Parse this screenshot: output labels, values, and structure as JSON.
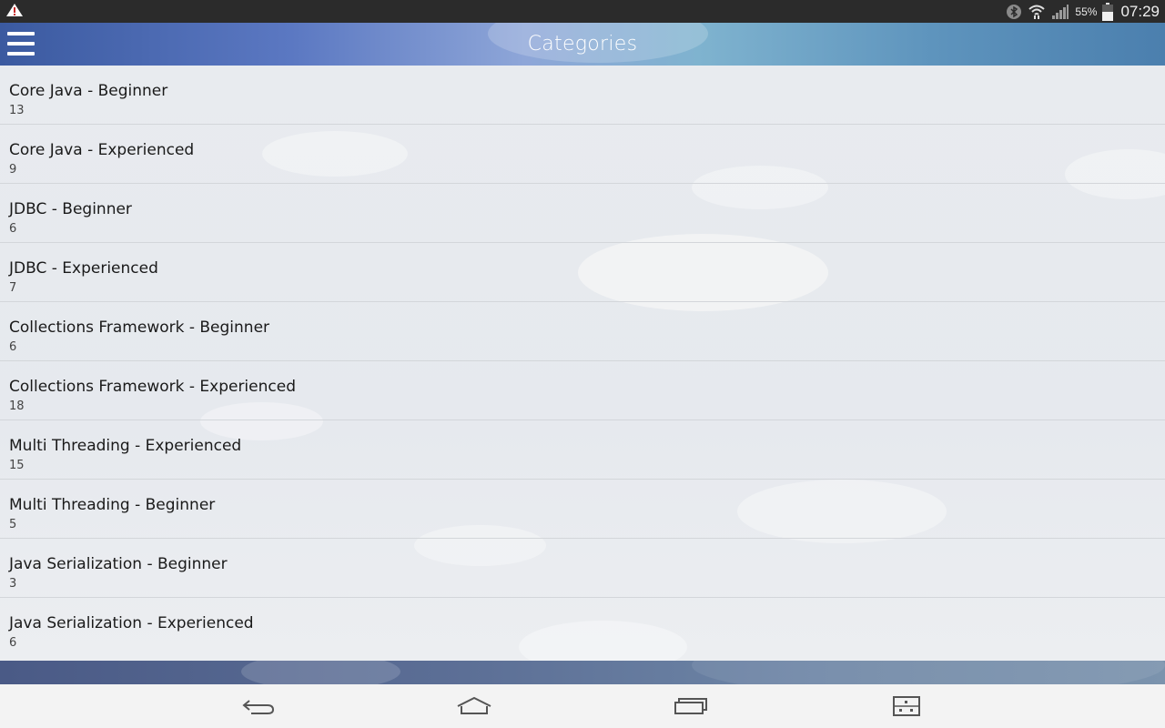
{
  "status_bar": {
    "battery_percent": "55%",
    "clock": "07:29",
    "icons": [
      "warning-icon",
      "bluetooth-icon",
      "wifi-icon",
      "signal-icon",
      "battery-icon"
    ]
  },
  "action_bar": {
    "title": "Categories",
    "menu_icon": "hamburger-menu-icon"
  },
  "categories": [
    {
      "name": "Core Java - Beginner",
      "count": "13"
    },
    {
      "name": "Core Java - Experienced",
      "count": "9"
    },
    {
      "name": "JDBC - Beginner",
      "count": "6"
    },
    {
      "name": "JDBC - Experienced",
      "count": "7"
    },
    {
      "name": "Collections Framework - Beginner",
      "count": "6"
    },
    {
      "name": "Collections Framework - Experienced",
      "count": "18"
    },
    {
      "name": "Multi Threading - Experienced",
      "count": "15"
    },
    {
      "name": "Multi Threading - Beginner",
      "count": "5"
    },
    {
      "name": "Java Serialization - Beginner",
      "count": "3"
    },
    {
      "name": "Java Serialization - Experienced",
      "count": "6"
    }
  ],
  "nav_bar": {
    "icons": [
      "back-icon",
      "home-icon",
      "recent-apps-icon",
      "screenshot-icon"
    ]
  },
  "colors": {
    "action_bar_start": "#3b5aa0",
    "action_bar_end": "#4b7fae",
    "list_background": "#e8ebef",
    "divider": "#d3d6da"
  }
}
